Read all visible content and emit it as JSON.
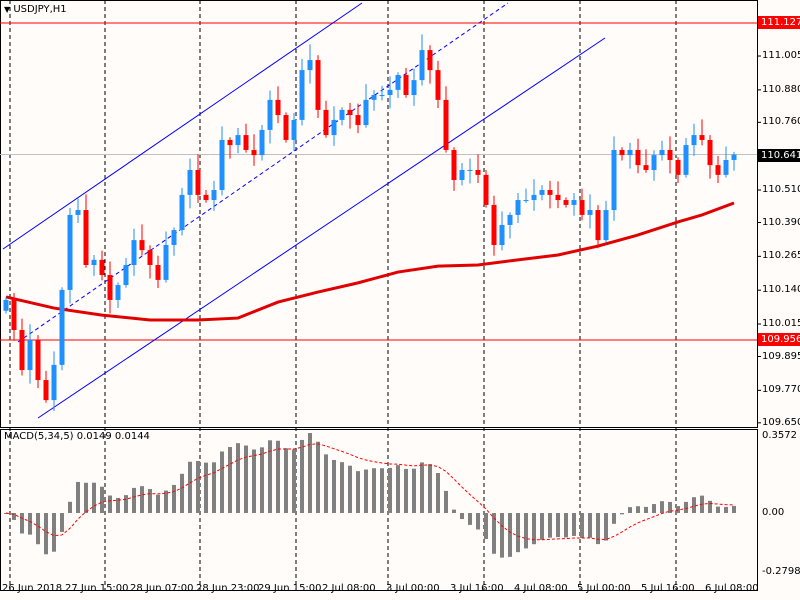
{
  "header": {
    "symbol_label": "USDJPY,H1"
  },
  "macd": {
    "label": "MACD(5,34,5) 0.0149 0.0144",
    "axis": [
      "0.3572",
      "0.00",
      "-0.2798"
    ]
  },
  "price_tags": {
    "upper": "111.127",
    "current": "110.641",
    "lower": "109.956"
  },
  "colors": {
    "bull": "#1e90ff",
    "bear": "#ff0000",
    "channel": "#0000ff",
    "ma": "#e00000",
    "hist": "#808080",
    "bg": "#fffcfa"
  },
  "chart_data": {
    "type": "candlestick",
    "symbol": "USDJPY",
    "timeframe": "H1",
    "price_axis": [
      "111.005",
      "110.880",
      "110.760",
      "110.510",
      "110.390",
      "110.265",
      "110.140",
      "110.015",
      "109.895",
      "109.770",
      "109.650"
    ],
    "time_axis": [
      "26 Jun 2018",
      "27 Jun 15:00",
      "28 Jun 07:00",
      "28 Jun 23:00",
      "29 Jun 15:00",
      "2 Jul 08:00",
      "3 Jul 00:00",
      "3 Jul 16:00",
      "4 Jul 08:00",
      "5 Jul 00:00",
      "5 Jul 16:00",
      "6 Jul 08:00"
    ],
    "ylim": [
      109.65,
      111.2
    ],
    "closes": [
      110.104,
      109.993,
      109.845,
      109.956,
      109.808,
      109.734,
      109.864,
      110.141,
      110.418,
      110.436,
      110.233,
      110.252,
      110.196,
      110.104,
      110.159,
      110.233,
      110.325,
      110.288,
      110.233,
      110.178,
      110.307,
      110.362,
      110.492,
      110.584,
      110.492,
      110.473,
      110.51,
      110.695,
      110.676,
      110.713,
      110.658,
      110.639,
      110.732,
      110.843,
      110.787,
      110.695,
      110.769,
      110.953,
      110.99,
      110.806,
      110.713,
      110.769,
      110.806,
      110.787,
      110.75,
      110.843,
      110.861,
      110.861,
      110.88,
      110.935,
      110.861,
      110.916,
      111.027,
      110.953,
      110.843,
      110.658,
      110.547,
      110.584,
      110.584,
      110.566,
      110.455,
      110.307,
      110.381,
      110.418,
      110.473,
      110.473,
      110.492,
      110.51,
      110.492,
      110.473,
      110.455,
      110.473,
      110.418,
      110.436,
      110.325,
      110.436,
      110.658,
      110.639,
      110.658,
      110.602,
      110.584,
      110.639,
      110.658,
      110.621,
      110.566,
      110.676,
      110.713,
      110.695,
      110.602,
      110.566,
      110.621,
      110.641
    ],
    "moving_average": {
      "index": [
        0,
        6,
        12,
        18,
        24,
        29,
        34,
        39,
        44,
        49,
        54,
        59,
        64,
        69,
        74,
        79,
        84,
        87,
        91
      ],
      "values": [
        110.115,
        110.074,
        110.048,
        110.03,
        110.03,
        110.037,
        110.096,
        110.133,
        110.167,
        110.207,
        110.229,
        110.233,
        110.252,
        110.27,
        110.303,
        110.344,
        110.392,
        110.418,
        110.462
      ]
    },
    "horizontal_levels": [
      111.127,
      110.641,
      109.956
    ]
  }
}
